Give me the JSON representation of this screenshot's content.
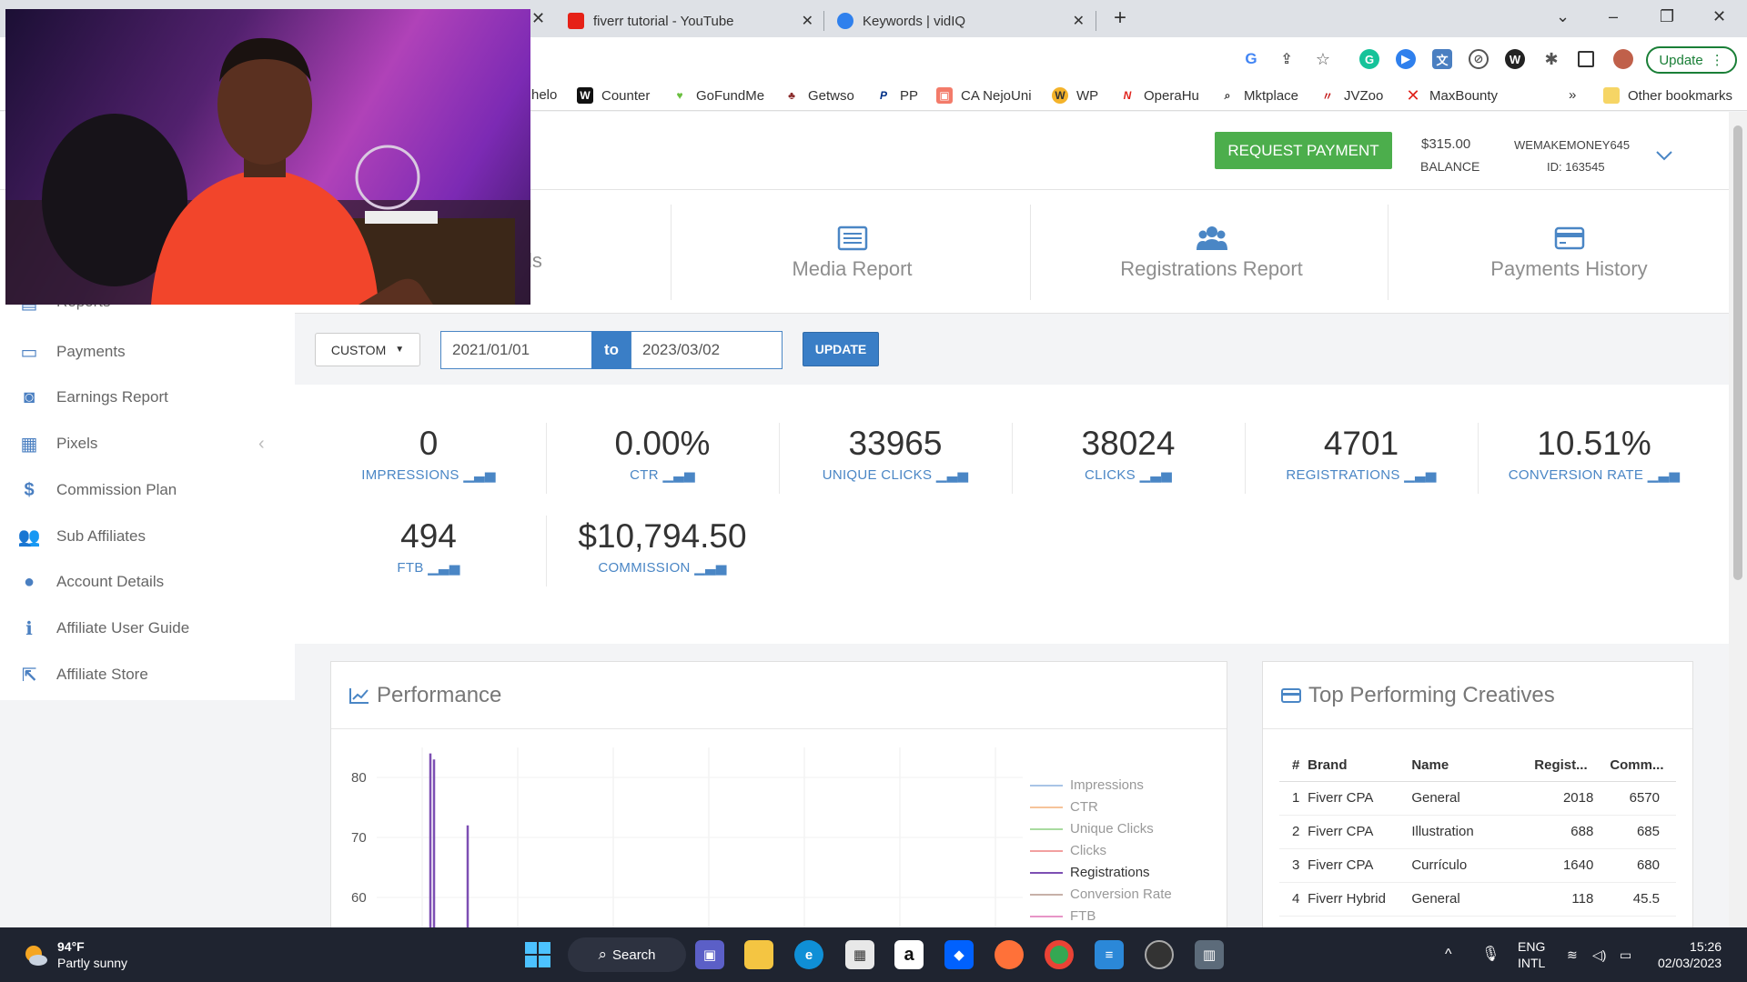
{
  "browser": {
    "tabs": [
      {
        "title": "fiverr tutorial - YouTube",
        "icon": "youtube-icon"
      },
      {
        "title": "Keywords | vidIQ",
        "icon": "vidiq-icon"
      }
    ],
    "new_tab": "+",
    "update_label": "Update",
    "bookmarks": [
      {
        "label": "helo"
      },
      {
        "label": "Counter",
        "icon_text": "W"
      },
      {
        "label": "GoFundMe"
      },
      {
        "label": "Getwso"
      },
      {
        "label": "PP"
      },
      {
        "label": "CA NejoUni"
      },
      {
        "label": "WP"
      },
      {
        "label": "OperaHu"
      },
      {
        "label": "Mktplace"
      },
      {
        "label": "JVZoo"
      },
      {
        "label": "MaxBounty"
      }
    ],
    "more_bookmarks": "»",
    "other_bookmarks": "Other bookmarks"
  },
  "header": {
    "request_payment": "REQUEST PAYMENT",
    "balance_value": "$315.00",
    "balance_label": "BALANCE",
    "username": "WEMAKEMONEY645",
    "user_id": "ID: 163545"
  },
  "report_tabs": [
    {
      "label": "ls"
    },
    {
      "label": "Media Report"
    },
    {
      "label": "Registrations Report"
    },
    {
      "label": "Payments History"
    }
  ],
  "sidebar": {
    "items": [
      {
        "label": "Reports"
      },
      {
        "label": "Payments"
      },
      {
        "label": "Earnings Report"
      },
      {
        "label": "Pixels"
      },
      {
        "label": "Commission Plan"
      },
      {
        "label": "Sub Affiliates"
      },
      {
        "label": "Account Details"
      },
      {
        "label": "Affiliate User Guide"
      },
      {
        "label": "Affiliate Store"
      }
    ]
  },
  "filter": {
    "range_type": "CUSTOM",
    "date_from": "2021/01/01",
    "to_label": "to",
    "date_to": "2023/03/02",
    "update_label": "UPDATE"
  },
  "stats": [
    {
      "value": "0",
      "label": "IMPRESSIONS"
    },
    {
      "value": "0.00%",
      "label": "CTR"
    },
    {
      "value": "33965",
      "label": "UNIQUE CLICKS"
    },
    {
      "value": "38024",
      "label": "CLICKS"
    },
    {
      "value": "4701",
      "label": "REGISTRATIONS"
    },
    {
      "value": "10.51%",
      "label": "CONVERSION RATE"
    },
    {
      "value": "494",
      "label": "FTB"
    },
    {
      "value": "$10,794.50",
      "label": "COMMISSION"
    }
  ],
  "performance": {
    "title": "Performance",
    "chart_data": {
      "type": "line",
      "title": "Performance",
      "ylim": [
        55,
        85
      ],
      "yticks": [
        "80",
        "70",
        "60"
      ],
      "grid": true,
      "legend_position": "right",
      "series": [
        {
          "name": "Impressions",
          "color": "#a9c4e6"
        },
        {
          "name": "CTR",
          "color": "#f6c49a"
        },
        {
          "name": "Unique Clicks",
          "color": "#a9dba0"
        },
        {
          "name": "Clicks",
          "color": "#f2a0a0"
        },
        {
          "name": "Registrations",
          "color": "#7d4fb3",
          "spikes": [
            {
              "label": "spike-1",
              "value": 84
            },
            {
              "label": "spike-2",
              "value": 83
            },
            {
              "label": "spike-3",
              "value": 72
            }
          ]
        },
        {
          "name": "Conversion Rate",
          "color": "#c7b1a8"
        },
        {
          "name": "FTB",
          "color": "#e795c7"
        }
      ]
    }
  },
  "creatives": {
    "title": "Top Performing Creatives",
    "columns": [
      "#",
      "Brand",
      "Name",
      "Regist...",
      "Comm..."
    ],
    "rows": [
      [
        "1",
        "Fiverr CPA",
        "General",
        "2018",
        "6570"
      ],
      [
        "2",
        "Fiverr CPA",
        "Illustration",
        "688",
        "685"
      ],
      [
        "3",
        "Fiverr CPA",
        "Currículo",
        "1640",
        "680"
      ],
      [
        "4",
        "Fiverr Hybrid",
        "General",
        "118",
        "45.5"
      ]
    ]
  },
  "taskbar": {
    "weather_temp": "94°F",
    "weather_desc": "Partly sunny",
    "search_label": "Search",
    "lang_1": "ENG",
    "lang_2": "INTL",
    "time": "15:26",
    "date": "02/03/2023"
  }
}
